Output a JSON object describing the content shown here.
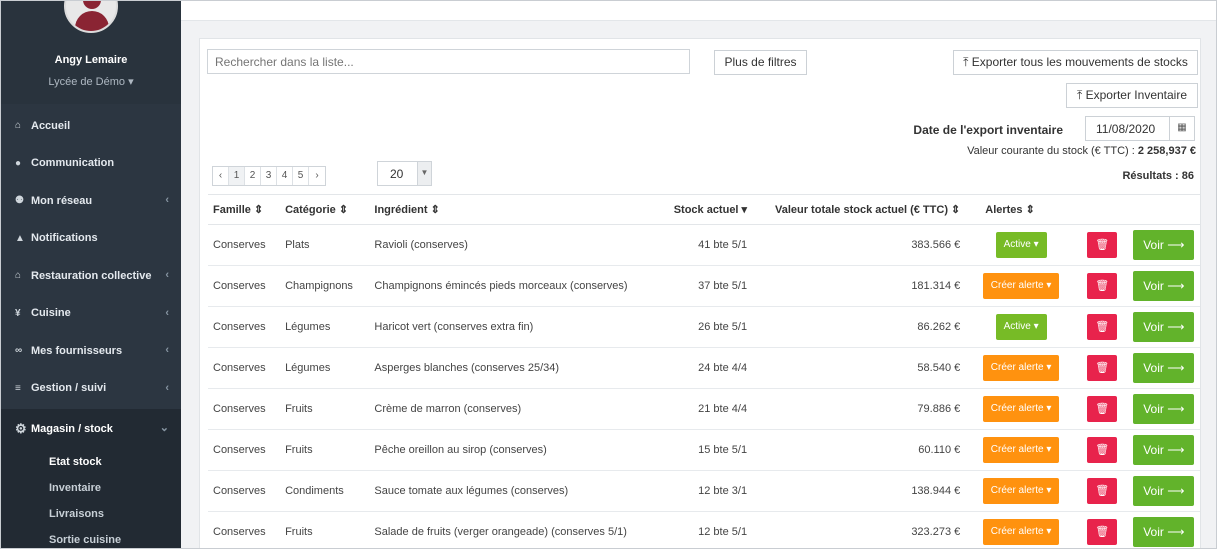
{
  "user": {
    "name": "Angy Lemaire",
    "school": "Lycée de Démo",
    "school_caret": "▾"
  },
  "nav": [
    {
      "icon": "⌂",
      "label": "Accueil",
      "chev": ""
    },
    {
      "icon": "●",
      "label": "Communication",
      "chev": ""
    },
    {
      "icon": "⚉",
      "label": "Mon réseau",
      "chev": "‹"
    },
    {
      "icon": "▲",
      "label": "Notifications",
      "chev": ""
    },
    {
      "icon": "⌂",
      "label": "Restauration collective",
      "chev": "‹"
    },
    {
      "icon": "¥",
      "label": "Cuisine",
      "chev": "‹"
    },
    {
      "icon": "∞",
      "label": "Mes fournisseurs",
      "chev": "‹"
    },
    {
      "icon": "≡",
      "label": "Gestion / suivi",
      "chev": "‹"
    }
  ],
  "nav_open": {
    "icon": "⚙",
    "label": "Magasin / stock",
    "chev": "⌄"
  },
  "sub_nav": [
    "Etat stock",
    "Inventaire",
    "Livraisons",
    "Sortie cuisine"
  ],
  "toolbar": {
    "search_placeholder": "Rechercher dans la liste...",
    "more_filters": "Plus de filtres",
    "export_movements": "⤒ Exporter tous les mouvements de stocks",
    "export_inventory": "⤒ Exporter Inventaire",
    "date_label": "Date de l'export inventaire",
    "date_value": "11/08/2020",
    "stock_value_label": "Valeur courante du stock (€ TTC) : ",
    "stock_value": "2 258,937 €",
    "results": "Résultats : 86"
  },
  "pager": {
    "prev": "‹",
    "pages": [
      "1",
      "2",
      "3",
      "4",
      "5"
    ],
    "next": "›",
    "per_page": "20"
  },
  "table": {
    "headers": {
      "famille": "Famille ⇕",
      "categorie": "Catégorie ⇕",
      "ingredient": "Ingrédient ⇕",
      "stock": "Stock actuel ▾",
      "valeur": "Valeur totale stock actuel (€ TTC) ⇕",
      "alertes": "Alertes ⇕"
    },
    "rows": [
      {
        "famille": "Conserves",
        "categorie": "Plats",
        "ingredient": "Ravioli (conserves)",
        "stock": "41 bte 5/1",
        "valeur": "383.566 €",
        "alerte": "Active ▾",
        "alerte_type": "active"
      },
      {
        "famille": "Conserves",
        "categorie": "Champignons",
        "ingredient": "Champignons émincés pieds morceaux (conserves)",
        "stock": "37 bte 5/1",
        "valeur": "181.314 €",
        "alerte": "Créer alerte ▾",
        "alerte_type": "create"
      },
      {
        "famille": "Conserves",
        "categorie": "Légumes",
        "ingredient": "Haricot vert (conserves extra fin)",
        "stock": "26 bte 5/1",
        "valeur": "86.262 €",
        "alerte": "Active ▾",
        "alerte_type": "active"
      },
      {
        "famille": "Conserves",
        "categorie": "Légumes",
        "ingredient": "Asperges blanches (conserves 25/34)",
        "stock": "24 bte 4/4",
        "valeur": "58.540 €",
        "alerte": "Créer alerte ▾",
        "alerte_type": "create"
      },
      {
        "famille": "Conserves",
        "categorie": "Fruits",
        "ingredient": "Crème de marron (conserves)",
        "stock": "21 bte 4/4",
        "valeur": "79.886 €",
        "alerte": "Créer alerte ▾",
        "alerte_type": "create"
      },
      {
        "famille": "Conserves",
        "categorie": "Fruits",
        "ingredient": "Pêche oreillon au sirop (conserves)",
        "stock": "15 bte 5/1",
        "valeur": "60.110 €",
        "alerte": "Créer alerte ▾",
        "alerte_type": "create"
      },
      {
        "famille": "Conserves",
        "categorie": "Condiments",
        "ingredient": "Sauce tomate aux légumes (conserves)",
        "stock": "12 bte 3/1",
        "valeur": "138.944 €",
        "alerte": "Créer alerte ▾",
        "alerte_type": "create"
      },
      {
        "famille": "Conserves",
        "categorie": "Fruits",
        "ingredient": "Salade de fruits (verger orangeade) (conserves 5/1)",
        "stock": "12 bte 5/1",
        "valeur": "323.273 €",
        "alerte": "Créer alerte ▾",
        "alerte_type": "create"
      }
    ],
    "delete_icon": "🗑",
    "view_label": "Voir ⟶"
  },
  "colors": {
    "sidebar": "#2c3641",
    "green": "#77bb26",
    "orange": "#ff920f",
    "red": "#e8234c"
  }
}
